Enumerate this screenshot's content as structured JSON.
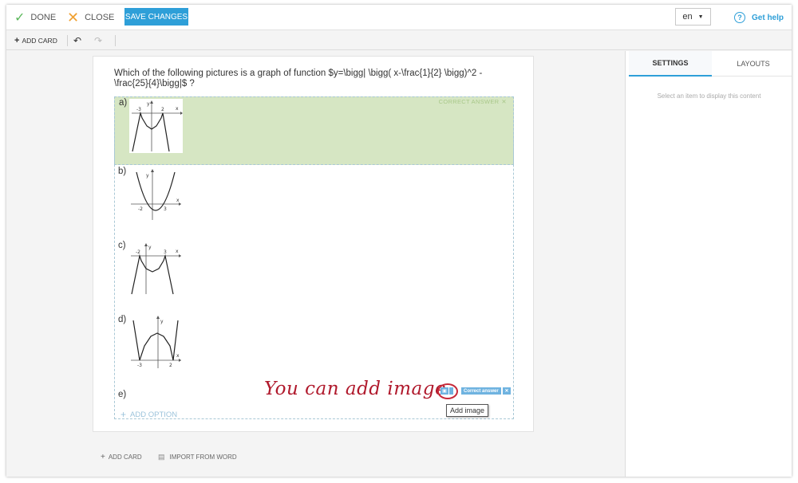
{
  "toolbar": {
    "done_label": "DONE",
    "close_label": "CLOSE",
    "save_label": "SAVE CHANGES",
    "language": "en",
    "help_label": "Get help",
    "add_card_label": "ADD CARD"
  },
  "question": {
    "text": "Which of the following pictures is a graph of function $y=\\bigg| \\bigg( x-\\frac{1}{2} \\bigg)^2 - \\frac{25}{4}\\bigg|$ ?",
    "options": [
      {
        "label": "a)",
        "correct": true,
        "correct_text": "CORRECT ANSWER",
        "graph": {
          "y": "y",
          "x": "x",
          "t1": "-3",
          "t2": "2"
        }
      },
      {
        "label": "b)",
        "correct": false,
        "graph": {
          "y": "y",
          "x": "x",
          "t1": "-2",
          "t2": "3"
        }
      },
      {
        "label": "c)",
        "correct": false,
        "graph": {
          "y": "y",
          "x": "x",
          "t1": "-2",
          "t2": "3"
        }
      },
      {
        "label": "d)",
        "correct": false,
        "graph": {
          "y": "y",
          "x": "x",
          "t1": "-3",
          "t2": "2"
        }
      },
      {
        "label": "e)",
        "correct": false
      }
    ],
    "add_option_label": "ADD OPTION",
    "correct_answer_button": "Correct answer",
    "add_image_tooltip": "Add image"
  },
  "annotation": "You can add image",
  "panel": {
    "tab_settings": "SETTINGS",
    "tab_layouts": "LAYOUTS",
    "empty_message": "Select an item to display this content"
  },
  "bottom": {
    "add_card_label": "ADD CARD",
    "import_label": "IMPORT FROM WORD"
  },
  "colors": {
    "accent": "#2e9fd8",
    "correct_bg": "#d6e6c3",
    "annotation": "#b0192c"
  }
}
